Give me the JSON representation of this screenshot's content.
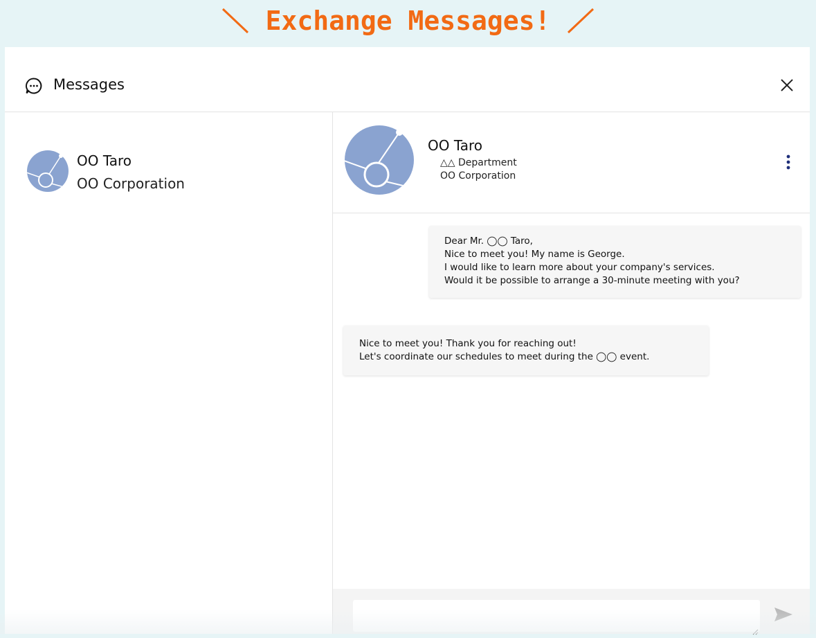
{
  "banner": {
    "text": "Exchange Messages!",
    "color": "#f26a14"
  },
  "header": {
    "title": "Messages",
    "icon": "chat-bubble-icon",
    "close_icon": "close-icon"
  },
  "contacts": [
    {
      "name": "OO  Taro",
      "company": "OO Corporation"
    }
  ],
  "chat": {
    "contact_name": "OO  Taro",
    "department": "△△ Department",
    "company": "OO Corporation",
    "more_icon": "more-vertical-icon",
    "messages": [
      {
        "direction": "outgoing",
        "lines": [
          "Dear Mr. ◯◯ Taro,",
          "Nice to meet you! My name is George.",
          "I would like to learn more about your company's services.",
          "Would it be possible to arrange a 30-minute meeting with you?"
        ]
      },
      {
        "direction": "incoming",
        "lines": [
          "Nice to meet you! Thank you for reaching out!",
          "Let's coordinate our schedules to meet during the ◯◯ event."
        ]
      }
    ]
  },
  "composer": {
    "value": "",
    "placeholder": "",
    "send_icon": "send-icon"
  },
  "colors": {
    "background": "#e6f4f6",
    "avatar": "#8aa3d0",
    "accent": "#1f2f7a"
  }
}
